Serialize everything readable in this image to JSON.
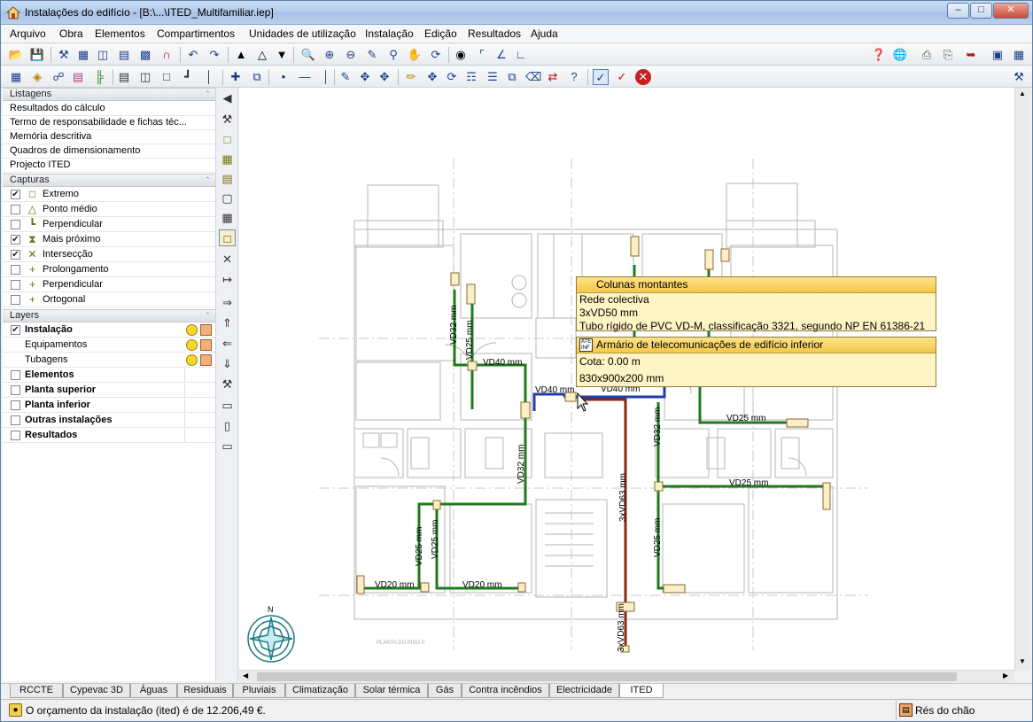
{
  "window": {
    "title": "Instalações do edifício - [B:\\...\\ITED_Multifamiliar.iep]"
  },
  "menu": [
    "Arquivo",
    "Obra",
    "Elementos",
    "Compartimentos",
    "Unidades de utilização",
    "Instalação",
    "Edição",
    "Resultados",
    "Ajuda"
  ],
  "panel": {
    "listagens_title": "Listagens",
    "listagens": [
      "Resultados do cálculo",
      "Termo de responsabilidade e fichas téc...",
      "Memória descritiva",
      "Quadros de dimensionamento",
      "Projecto ITED"
    ],
    "capturas_title": "Capturas",
    "capturas": [
      {
        "label": "Extremo",
        "checked": true,
        "icon": "square-snap-icon"
      },
      {
        "label": "Ponto médio",
        "checked": false,
        "icon": "triangle-snap-icon"
      },
      {
        "label": "Perpendicular",
        "checked": false,
        "icon": "perpendicular-snap-icon"
      },
      {
        "label": "Mais próximo",
        "checked": true,
        "icon": "hourglass-snap-icon"
      },
      {
        "label": "Intersecção",
        "checked": true,
        "icon": "cross-snap-icon"
      },
      {
        "label": "Prolongamento",
        "checked": false,
        "icon": "plus-snap-icon"
      },
      {
        "label": "Perpendicular",
        "checked": false,
        "icon": "plus-snap-icon"
      },
      {
        "label": "Ortogonal",
        "checked": false,
        "icon": "plus-snap-icon"
      }
    ],
    "layers_title": "Layers",
    "layers": [
      {
        "label": "Instalação",
        "checked": true,
        "bold": true,
        "indent": false
      },
      {
        "label": "Equipamentos",
        "checked": null,
        "bold": false,
        "indent": true
      },
      {
        "label": "Tubagens",
        "checked": null,
        "bold": false,
        "indent": true
      },
      {
        "label": "Elementos",
        "checked": false,
        "bold": true,
        "indent": false
      },
      {
        "label": "Planta superior",
        "checked": false,
        "bold": true,
        "indent": false
      },
      {
        "label": "Planta inferior",
        "checked": false,
        "bold": true,
        "indent": false
      },
      {
        "label": "Outras instalações",
        "checked": false,
        "bold": true,
        "indent": false
      },
      {
        "label": "Resultados",
        "checked": false,
        "bold": true,
        "indent": false
      }
    ]
  },
  "tooltip1": {
    "title": "Colunas montantes",
    "lines": [
      "Rede colectiva",
      "3xVD50 mm",
      "Tubo rígido de PVC VD-M, classificação 3321, segundo NP EN 61386-21"
    ]
  },
  "tooltip2": {
    "title": "Armário de telecomunicações de edifício inferior",
    "lines": [
      "Cota: 0.00 m",
      "830x900x200 mm"
    ],
    "badge": "ATE INF"
  },
  "plan_labels": {
    "vd32_a": "VD32 mm",
    "vd25_a": "VD25 mm",
    "vd40_a": "VD40 mm",
    "vd40_b": "VD40 mm",
    "vd40_c": "VD40 mm",
    "vd32_b": "VD32 mm",
    "vd25_b": "VD25 mm",
    "vd25_c": "VD25 mm",
    "vd20_a": "VD20 mm",
    "vd20_b": "VD20 mm",
    "vd63_a": "3xVD63 mm",
    "vd63_b": "3xVD63 mm",
    "vd32_c": "VD32 mm",
    "vd25_d": "VD25 mm",
    "vd25_e": "VD25 mm",
    "vd25_f": "VD25 mm",
    "north": "N",
    "plant": "PLANTA DO PISO 0"
  },
  "tabs": [
    "RCCTE",
    "Cypevac 3D",
    "Águas",
    "Residuais",
    "Pluviais",
    "Climatização",
    "Solar térmica",
    "Gás",
    "Contra incêndios",
    "Electricidade",
    "ITED"
  ],
  "active_tab": "ITED",
  "status": {
    "message": "O orçamento da instalação (ited) é de 12.206,49 €.",
    "floor": "Rés do chão"
  },
  "colors": {
    "green": "#1d7a1d",
    "blue": "#1f3fa8",
    "brown": "#8a2a10",
    "tip_bg": "#fff4c4"
  }
}
